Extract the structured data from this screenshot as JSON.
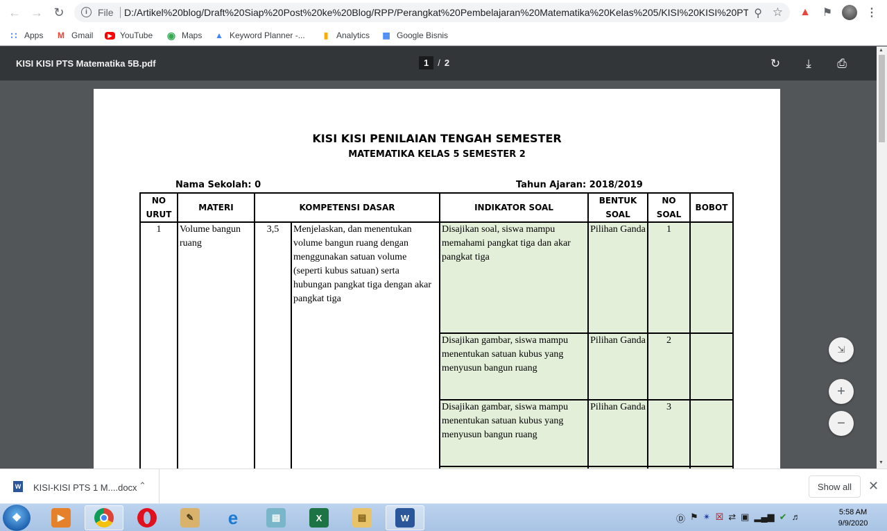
{
  "browser": {
    "scheme_label": "File",
    "url": "D:/Artikel%20blog/Draft%20Siap%20Post%20ke%20Blog/RPP/Perangkat%20Pembelajaran%20Matematika%20Kelas%205/KISI%20KISI%20PTS..."
  },
  "bookmarks": [
    {
      "label": "Apps",
      "icon": "apps-grid-icon"
    },
    {
      "label": "Gmail",
      "icon": "gmail-icon"
    },
    {
      "label": "YouTube",
      "icon": "youtube-icon"
    },
    {
      "label": "Maps",
      "icon": "maps-icon"
    },
    {
      "label": "Keyword Planner -...",
      "icon": "google-ads-icon"
    },
    {
      "label": "Analytics",
      "icon": "analytics-icon"
    },
    {
      "label": "Google Bisnis",
      "icon": "google-business-icon"
    }
  ],
  "pdf": {
    "filename": "KISI KISI PTS Matematika 5B.pdf",
    "current_page": "1",
    "page_separator": "/",
    "total_pages": "2"
  },
  "document": {
    "title": "KISI KISI PENILAIAN TENGAH SEMESTER",
    "subtitle": "MATEMATIKA KELAS 5 SEMESTER 2",
    "school_label": "Nama Sekolah:  0",
    "year_label": "Tahun Ajaran:  2018/2019",
    "headers": {
      "no_urut": [
        "NO",
        "URUT"
      ],
      "materi": "MATERI",
      "kd": "KOMPETENSI DASAR",
      "indikator": "INDIKATOR SOAL",
      "bentuk": [
        "BENTUK",
        "SOAL"
      ],
      "no_soal": [
        "NO",
        "SOAL"
      ],
      "bobot": "BOBOT"
    },
    "row": {
      "no": "1",
      "materi": "Volume bangun ruang",
      "kd_no": "3,5",
      "kd_text": "Menjelaskan, dan menentukan volume bangun ruang dengan menggunakan satuan volume (seperti kubus satuan) serta hubungan pangkat tiga dengan akar pangkat tiga"
    },
    "items": [
      {
        "indikator": "Disajikan soal, siswa mampu memahami pangkat tiga dan akar pangkat tiga",
        "bentuk": "Pilihan Ganda",
        "no_soal": "1",
        "bobot": ""
      },
      {
        "indikator": "Disajikan gambar, siswa mampu menentukan satuan kubus yang menyusun bangun ruang",
        "bentuk": "Pilihan Ganda",
        "no_soal": "2",
        "bobot": ""
      },
      {
        "indikator": "Disajikan gambar, siswa mampu menentukan satuan kubus yang menyusun bangun ruang",
        "bentuk": "Pilihan Ganda",
        "no_soal": "3",
        "bobot": ""
      }
    ],
    "highlight_color": "#e3efd9"
  },
  "download_shelf": {
    "file_name": "KISI-KISI PTS 1 M....docx",
    "show_all_label": "Show all"
  },
  "taskbar": {
    "time": "5:58 AM",
    "date": "9/9/2020"
  }
}
